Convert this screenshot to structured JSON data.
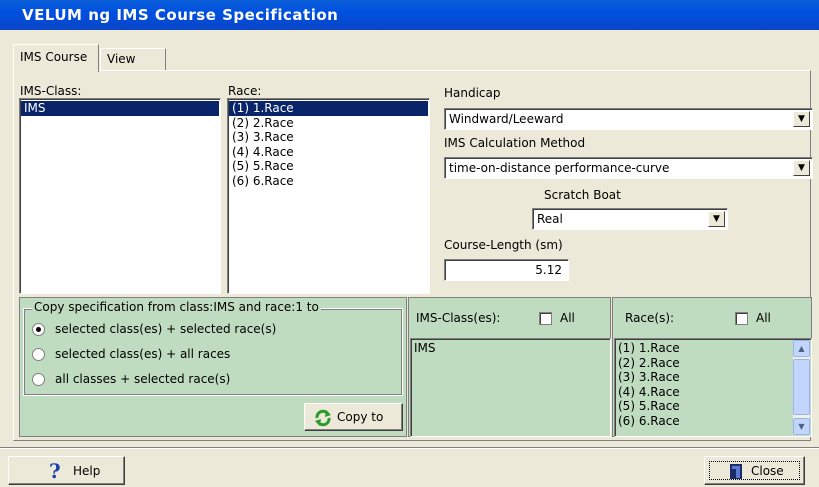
{
  "window": {
    "title": "VELUM ng IMS Course Specification"
  },
  "tabs": [
    {
      "label": "IMS Course",
      "active": true
    },
    {
      "label": "View",
      "active": false
    }
  ],
  "ims_class": {
    "label": "IMS-Class:",
    "items": [
      "IMS"
    ],
    "selected_index": 0
  },
  "race": {
    "label": "Race:",
    "items": [
      "(1) 1.Race",
      "(2) 2.Race",
      "(3) 3.Race",
      "(4) 4.Race",
      "(5) 5.Race",
      "(6) 6.Race"
    ],
    "selected_index": 0
  },
  "handicap": {
    "label": "Handicap",
    "value": "Windward/Leeward"
  },
  "calc_method": {
    "label": "IMS Calculation Method",
    "value": "time-on-distance performance-curve"
  },
  "scratch_boat": {
    "label": "Scratch Boat",
    "value": "Real"
  },
  "course_length": {
    "label": "Course-Length (sm)",
    "value": "5.12"
  },
  "copy_spec": {
    "group_title": "Copy specification from class:IMS and race:1 to",
    "options": [
      {
        "label": "selected class(es) + selected race(s)",
        "selected": true
      },
      {
        "label": "selected class(es) + all races",
        "selected": false
      },
      {
        "label": "all classes + selected race(s)",
        "selected": false
      }
    ],
    "copy_button": "Copy to"
  },
  "target_classes": {
    "label": "IMS-Class(es):",
    "all_label": "All",
    "items": [
      "IMS"
    ]
  },
  "target_races": {
    "label": "Race(s):",
    "all_label": "All",
    "items": [
      "(1) 1.Race",
      "(2) 2.Race",
      "(3) 3.Race",
      "(4) 4.Race",
      "(5) 5.Race",
      "(6) 6.Race"
    ]
  },
  "footer": {
    "help_label": "Help",
    "close_label": "Close"
  },
  "colors": {
    "title_bar": "#0054e3",
    "panel_green": "#c0dcc0",
    "selection": "#0a246a",
    "face": "#ece9d8"
  },
  "icons": [
    "help-question-icon",
    "close-door-icon",
    "refresh-copy-icon",
    "dropdown-arrow-icon"
  ]
}
